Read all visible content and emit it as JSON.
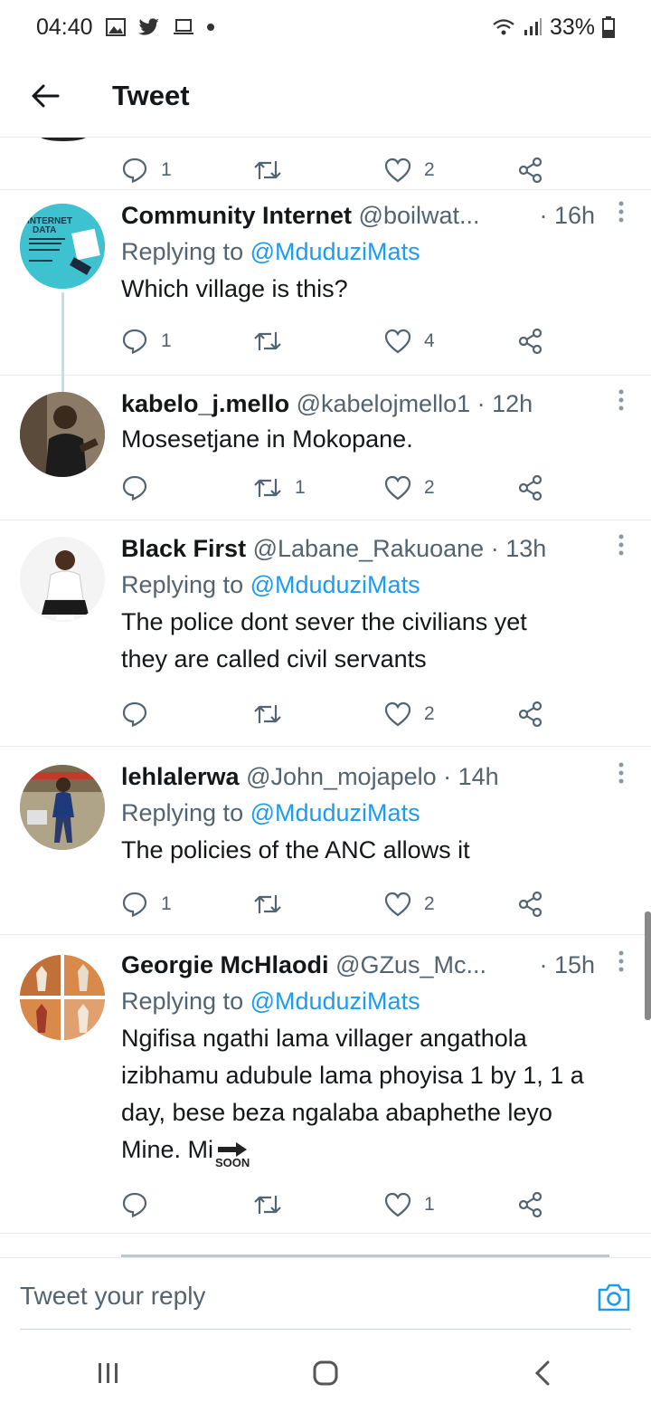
{
  "status": {
    "time": "04:40",
    "battery": "33%"
  },
  "header": {
    "title": "Tweet"
  },
  "top_actions": {
    "reply_count": "1",
    "like_count": "2"
  },
  "tweets": [
    {
      "name": "Community Internet",
      "handle": "@boilwat...",
      "time": "· 16h",
      "replying_prefix": "Replying to ",
      "replying_to": "@MduduziMats",
      "text": "Which village is this?",
      "reply_count": "1",
      "retweet_count": "",
      "like_count": "4",
      "avatar_lines": [
        "INTERNET",
        "DATA"
      ]
    },
    {
      "name": "kabelo_j.mello",
      "handle": "@kabelojmello1",
      "time": "· 12h",
      "text": "Mosesetjane in Mokopane.",
      "reply_count": "",
      "retweet_count": "1",
      "like_count": "2"
    },
    {
      "name": "Black First",
      "handle": "@Labane_Rakuoane",
      "time": "· 13h",
      "replying_prefix": "Replying to ",
      "replying_to": "@MduduziMats",
      "text_lines": [
        "The police dont sever the civilians yet",
        "they are called civil servants"
      ],
      "reply_count": "",
      "retweet_count": "",
      "like_count": "2"
    },
    {
      "name": "lehlalerwa",
      "handle": "@John_mojapelo",
      "time": "· 14h",
      "replying_prefix": "Replying to ",
      "replying_to": "@MduduziMats",
      "text": "The policies of the ANC allows it",
      "reply_count": "1",
      "retweet_count": "",
      "like_count": "2"
    },
    {
      "name": "Georgie McHlaodi",
      "handle": "@GZus_Mc...",
      "time": "· 15h",
      "replying_prefix": "Replying to ",
      "replying_to": "@MduduziMats",
      "text_lines": [
        "Ngifisa ngathi lama villager angathola",
        "izibhamu adubule lama phoyisa 1 by 1, 1 a",
        "day, bese beza ngalaba abaphethe leyo"
      ],
      "text_last": "Mine. Mi",
      "emoji_label": "SOON",
      "reply_count": "",
      "retweet_count": "",
      "like_count": "1"
    }
  ],
  "reply_bar": {
    "placeholder": "Tweet your reply"
  },
  "colors": {
    "accent": "#1d9bf0",
    "secondary_text": "#536471",
    "divider": "#e6ecf0"
  }
}
